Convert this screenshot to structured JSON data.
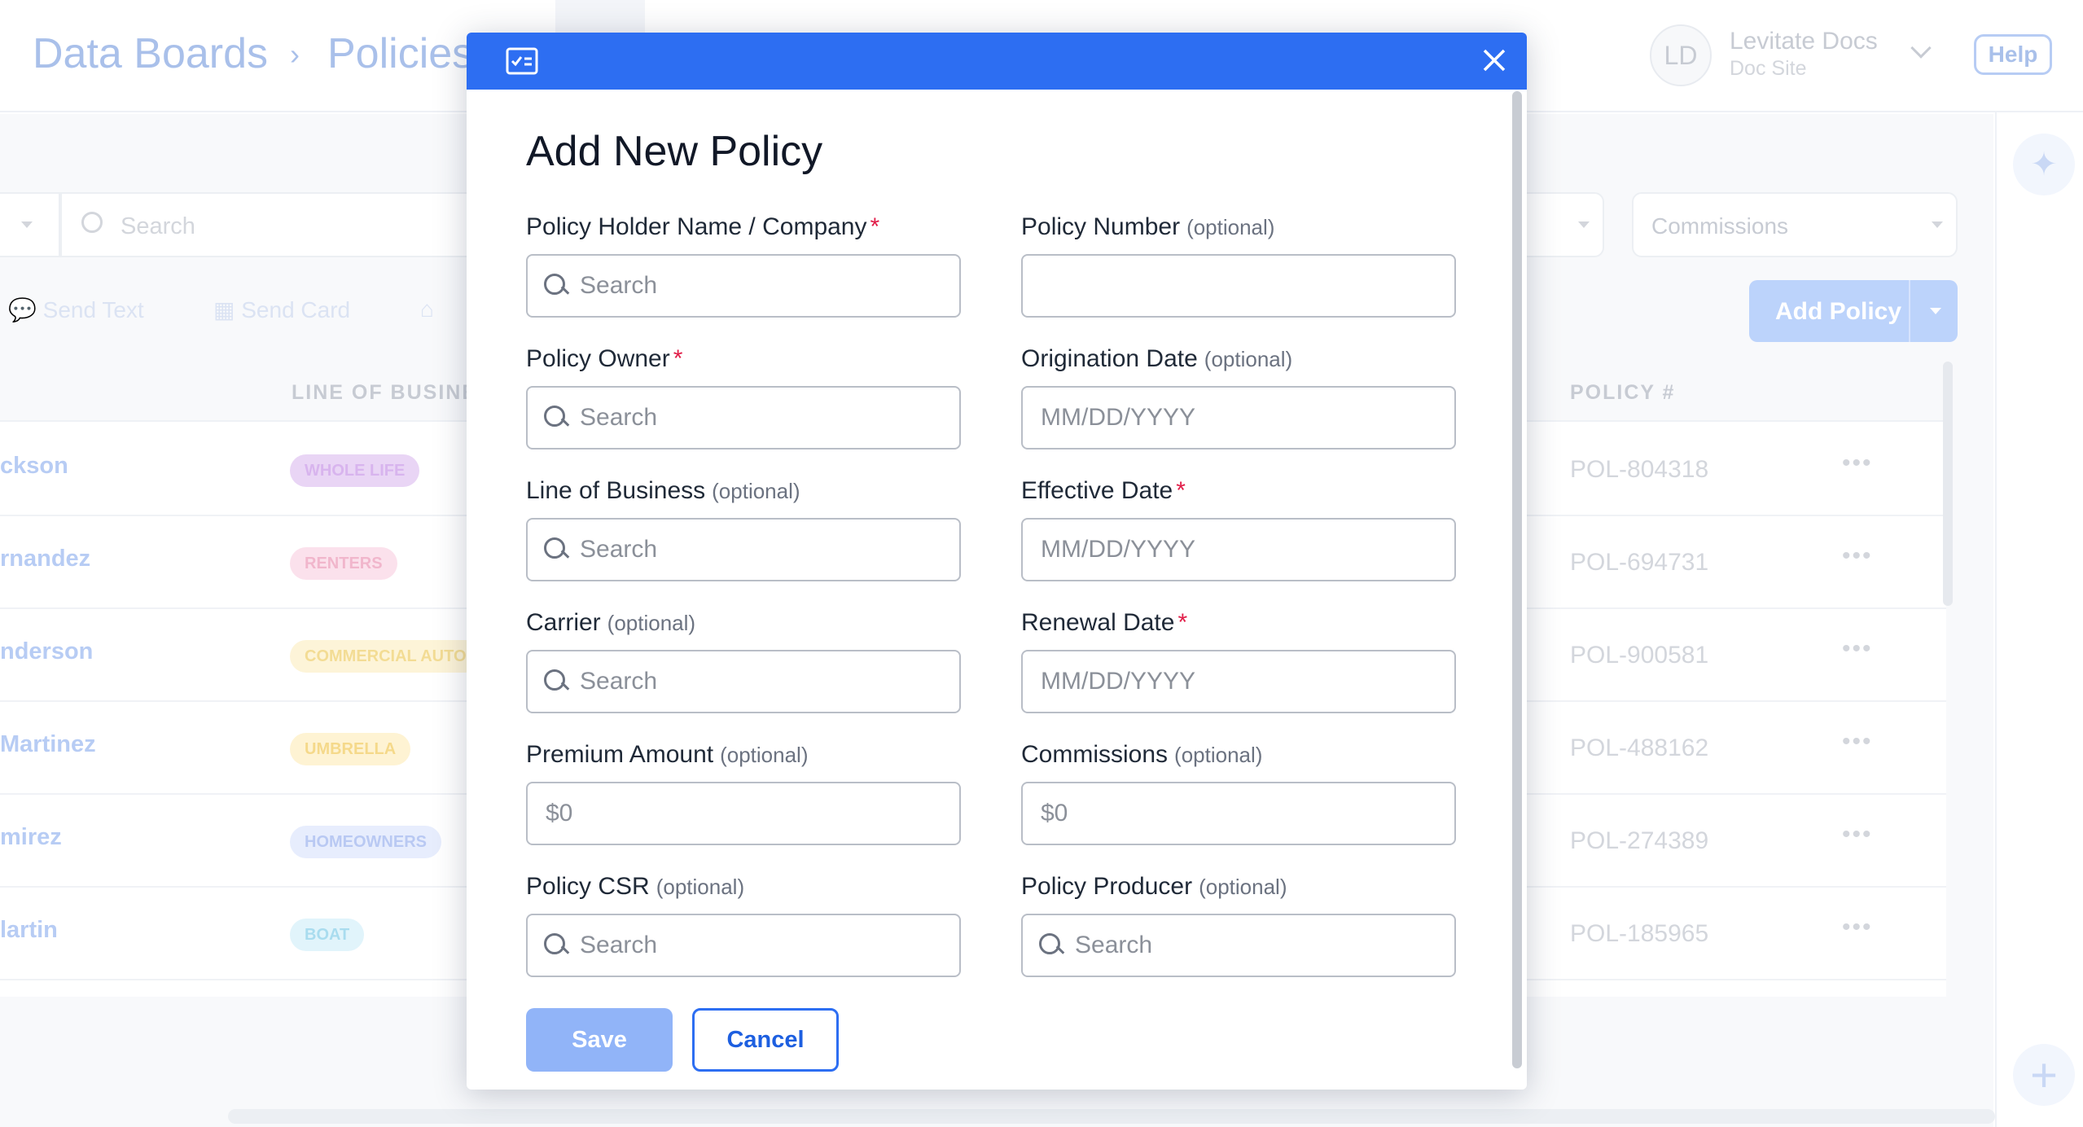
{
  "header": {
    "breadcrumb": [
      "Data Boards",
      "Policies"
    ],
    "breadcrumb_separator": "›",
    "user_initials": "LD",
    "user_name": "Levitate Docs",
    "user_subtitle": "Doc Site",
    "help_label": "Help"
  },
  "toolbar": {
    "search_placeholder": "Search",
    "commissions_filter": "Commissions",
    "send_text_label": "Send Text",
    "send_card_label": "Send Card",
    "add_policy_label": "Add Policy"
  },
  "table": {
    "columns": [
      "LINE OF BUSINESS",
      "POLICY #"
    ],
    "rows": [
      {
        "name": "ckson",
        "line": "WHOLE LIFE",
        "line_color": "#e9d5f5",
        "line_text": "#d8b4ee",
        "policy": "POL-804318"
      },
      {
        "name": "rnandez",
        "line": "RENTERS",
        "line_color": "#fbe1ec",
        "line_text": "#f1b6cc",
        "policy": "POL-694731"
      },
      {
        "name": "nderson",
        "line": "COMMERCIAL AUTO",
        "line_color": "#fdf4d8",
        "line_text": "#f3dc94",
        "policy": "POL-900581"
      },
      {
        "name": "Martinez",
        "line": "UMBRELLA",
        "line_color": "#fef3d3",
        "line_text": "#f5d98a",
        "policy": "POL-488162"
      },
      {
        "name": "mirez",
        "line": "HOMEOWNERS",
        "line_color": "#e7edfd",
        "line_text": "#b9c9f3",
        "policy": "POL-274389"
      },
      {
        "name": "lartin",
        "line": "BOAT",
        "line_color": "#e1f4fb",
        "line_text": "#a9dcef",
        "policy": "POL-185965"
      }
    ]
  },
  "modal": {
    "title": "Add New Policy",
    "save_label": "Save",
    "cancel_label": "Cancel",
    "optional_text": "(optional)",
    "required_mark": "*",
    "fields": {
      "holder": {
        "label": "Policy Holder Name / Company",
        "placeholder": "Search"
      },
      "number": {
        "label": "Policy Number",
        "placeholder": ""
      },
      "owner": {
        "label": "Policy Owner",
        "placeholder": "Search"
      },
      "origination": {
        "label": "Origination Date",
        "placeholder": "MM/DD/YYYY"
      },
      "line": {
        "label": "Line of Business",
        "placeholder": "Search"
      },
      "effective": {
        "label": "Effective Date",
        "placeholder": "MM/DD/YYYY"
      },
      "carrier": {
        "label": "Carrier",
        "placeholder": "Search"
      },
      "renewal": {
        "label": "Renewal Date",
        "placeholder": "MM/DD/YYYY"
      },
      "premium": {
        "label": "Premium Amount",
        "placeholder": "$0"
      },
      "commissions": {
        "label": "Commissions",
        "placeholder": "$0"
      },
      "csr": {
        "label": "Policy CSR",
        "placeholder": "Search"
      },
      "producer": {
        "label": "Policy Producer",
        "placeholder": "Search"
      }
    }
  },
  "colors": {
    "accent": "#2d6ef2",
    "required": "#e11d48"
  },
  "icons": [
    "form-icon",
    "close-icon",
    "search-icon",
    "chevron-down-icon",
    "sparkle-icon",
    "plus-icon",
    "chat-icon",
    "card-icon",
    "tag-icon"
  ]
}
